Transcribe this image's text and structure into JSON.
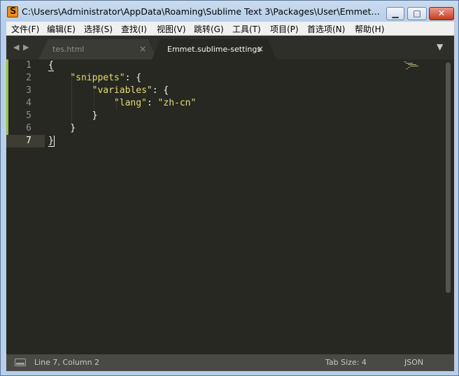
{
  "window": {
    "title": "C:\\Users\\Administrator\\AppData\\Roaming\\Sublime Text 3\\Packages\\User\\Emmet.sublime-settings - Sublime Text",
    "app_icon": "sublime-text-icon",
    "minimize_glyph": "▁",
    "maximize_glyph": "□",
    "close_glyph": "✕"
  },
  "menu": {
    "items": [
      {
        "label": "文件(F)"
      },
      {
        "label": "编辑(E)"
      },
      {
        "label": "选择(S)"
      },
      {
        "label": "查找(I)"
      },
      {
        "label": "视图(V)"
      },
      {
        "label": "跳转(G)"
      },
      {
        "label": "工具(T)"
      },
      {
        "label": "项目(P)"
      },
      {
        "label": "首选项(N)"
      },
      {
        "label": "帮助(H)"
      }
    ]
  },
  "tabs": {
    "nav_left": "◀",
    "nav_right": "▶",
    "items": [
      {
        "label": "tes.html",
        "close": "×",
        "active": false
      },
      {
        "label": "Emmet.sublime-settings",
        "close": "×",
        "active": true
      }
    ],
    "dropdown": "▼"
  },
  "editor": {
    "line_numbers": [
      "1",
      "2",
      "3",
      "4",
      "5",
      "6",
      "7"
    ],
    "current_line": "7",
    "lines": [
      {
        "parts": [
          {
            "text": "{",
            "cls": ""
          }
        ]
      },
      {
        "parts": [
          {
            "text": "    ",
            "cls": ""
          },
          {
            "text": "\"snippets\"",
            "cls": "tok-key"
          },
          {
            "text": ": {",
            "cls": ""
          }
        ]
      },
      {
        "parts": [
          {
            "text": "        ",
            "cls": ""
          },
          {
            "text": "\"variables\"",
            "cls": "tok-key"
          },
          {
            "text": ": {",
            "cls": ""
          }
        ]
      },
      {
        "parts": [
          {
            "text": "            ",
            "cls": ""
          },
          {
            "text": "\"lang\"",
            "cls": "tok-key"
          },
          {
            "text": ": ",
            "cls": ""
          },
          {
            "text": "\"zh-cn\"",
            "cls": "tok-str"
          }
        ]
      },
      {
        "parts": [
          {
            "text": "        }",
            "cls": ""
          }
        ]
      },
      {
        "parts": [
          {
            "text": "    }",
            "cls": ""
          }
        ]
      },
      {
        "parts": [
          {
            "text": "}",
            "cls": ""
          }
        ]
      }
    ],
    "colors": {
      "background": "#272822",
      "text": "#f8f8f2",
      "string": "#e6db74",
      "gutter_modified": "#9bc03a"
    }
  },
  "status": {
    "panel_icon": "panel-toggle-icon",
    "position": "Line 7, Column 2",
    "tab_size": "Tab Size: 4",
    "syntax": "JSON"
  }
}
